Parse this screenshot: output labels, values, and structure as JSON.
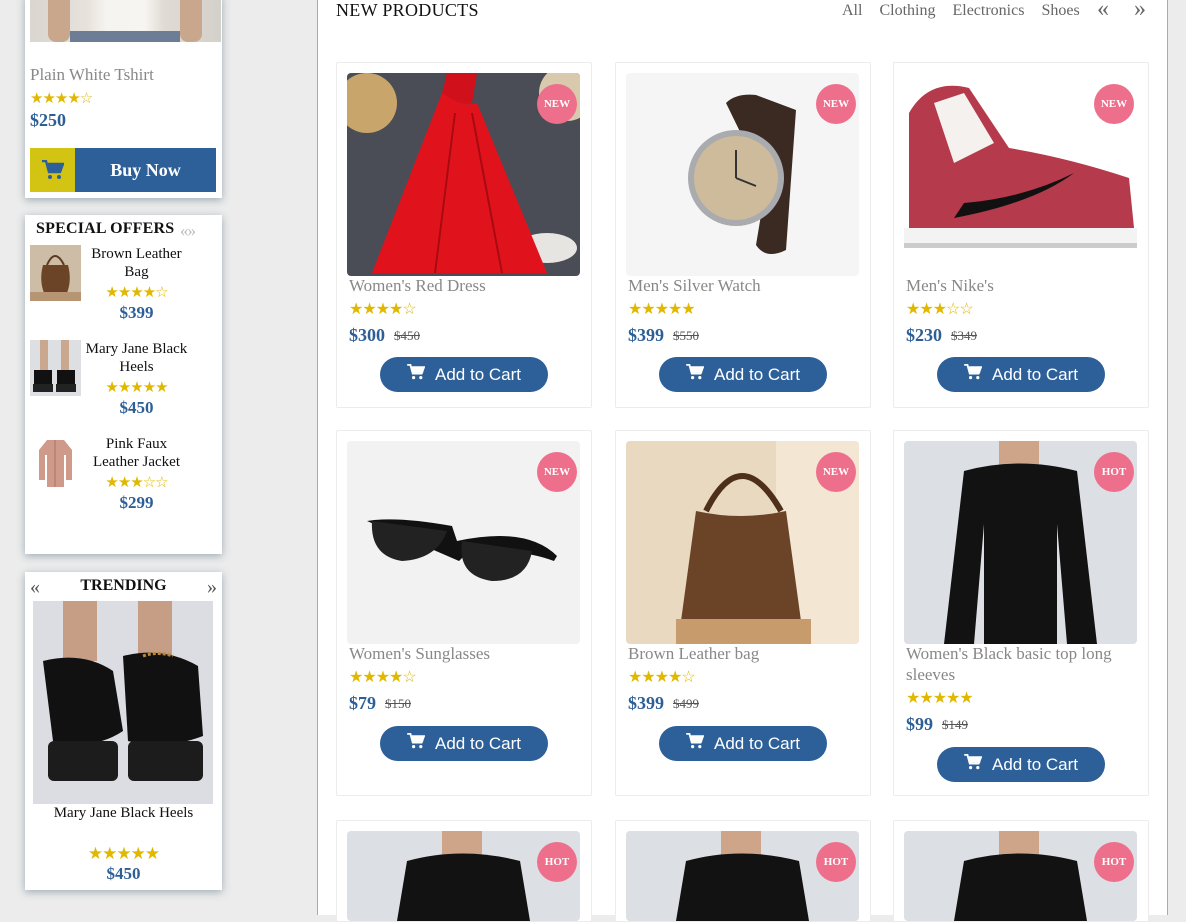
{
  "sidebar": {
    "featured": {
      "name": "Plain White Tshirt",
      "stars": "★★★★☆",
      "price": "$250",
      "buy_label": "Buy Now",
      "cart_icon": "cart-icon"
    },
    "special_offers": {
      "title": "SPECIAL OFFERS",
      "arrows": "«»",
      "items": [
        {
          "name": "Brown Leather Bag",
          "stars": "★★★★☆",
          "price": "$399"
        },
        {
          "name": "Mary Jane Black Heels",
          "stars": "★★★★★",
          "price": "$450"
        },
        {
          "name": "Pink Faux Leather Jacket",
          "stars": "★★★☆☆",
          "price": "$299"
        }
      ]
    },
    "trending": {
      "title": "TRENDING",
      "prev": "«",
      "next": "»",
      "item": {
        "name": "Mary Jane Black Heels",
        "stars": "★★★★★",
        "price": "$450"
      }
    }
  },
  "main": {
    "title": "NEW PRODUCTS",
    "filters": [
      "All",
      "Clothing",
      "Electronics",
      "Shoes"
    ],
    "prev": "«",
    "next": "»",
    "add_label": "Add to Cart",
    "products": [
      {
        "name": "Women's Red Dress",
        "stars": "★★★★☆",
        "price": "$300",
        "old": "$450",
        "badge": "NEW"
      },
      {
        "name": "Men's Silver Watch",
        "stars": "★★★★★",
        "price": "$399",
        "old": "$550",
        "badge": "NEW"
      },
      {
        "name": "Men's Nike's",
        "stars": "★★★☆☆",
        "price": "$230",
        "old": "$349",
        "badge": "NEW"
      },
      {
        "name": "Women's Sunglasses",
        "stars": "★★★★☆",
        "price": "$79",
        "old": "$150",
        "badge": "NEW"
      },
      {
        "name": "Brown Leather bag",
        "stars": "★★★★☆",
        "price": "$399",
        "old": "$499",
        "badge": "NEW"
      },
      {
        "name": "Women's Black basic top long sleeves",
        "stars": "★★★★★",
        "price": "$99",
        "old": "$149",
        "badge": "HOT"
      },
      {
        "badge": "HOT"
      },
      {
        "badge": "HOT"
      },
      {
        "badge": "HOT"
      }
    ]
  },
  "colors": {
    "accent": "#2d6099",
    "badge": "#ee6f8b",
    "stars": "#e0b800",
    "price": "#2d5f96",
    "cart_box": "#d3c413"
  }
}
